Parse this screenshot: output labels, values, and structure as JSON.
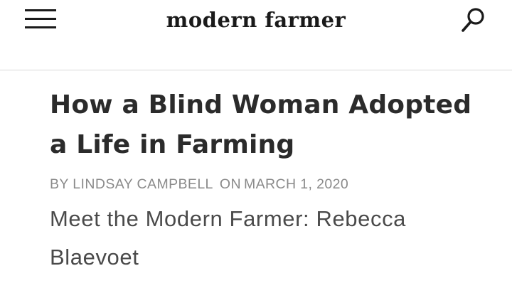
{
  "header": {
    "logo_text": "modern farmer",
    "menu_icon": "hamburger-menu-icon",
    "search_icon": "search-icon"
  },
  "article": {
    "title": "How a Blind Woman Adopted a Life in Farming",
    "byline": {
      "by_label": "BY",
      "author": "LINDSAY CAMPBELL",
      "on_label": "ON",
      "date": "MARCH 1, 2020"
    },
    "dek": "Meet the Modern Farmer: Rebecca Blaevoet"
  },
  "colors": {
    "text_dark": "#2b2b2b",
    "byline_gray": "#8a8a8a",
    "divider": "#d9d9d9"
  }
}
